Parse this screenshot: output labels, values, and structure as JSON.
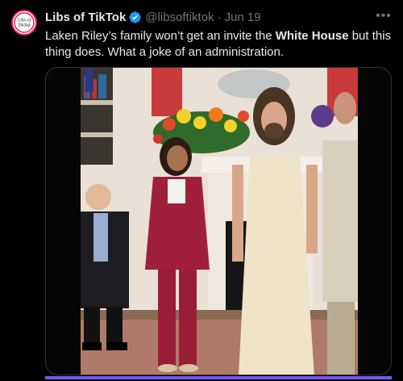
{
  "tweet": {
    "display_name": "Libs of TikTok",
    "handle": "@libsoftiktok",
    "separator": "·",
    "date": "Jun 19",
    "text_before": "Laken Riley’s family won’t get an invite the ",
    "text_bold": "White House",
    "text_after": " but this thing does. What a joke of an administration.",
    "avatar_text_top": "Libs of",
    "avatar_text_bottom": "TikTok"
  },
  "media": {
    "type": "video",
    "progress": 1.0
  },
  "icons": {
    "verified": "verified-badge-icon",
    "more": "more-options-icon"
  },
  "colors": {
    "background": "#000000",
    "text": "#e7e9ea",
    "muted": "#71767b",
    "verified": "#1d9bf0",
    "progress": "#7856ff"
  }
}
